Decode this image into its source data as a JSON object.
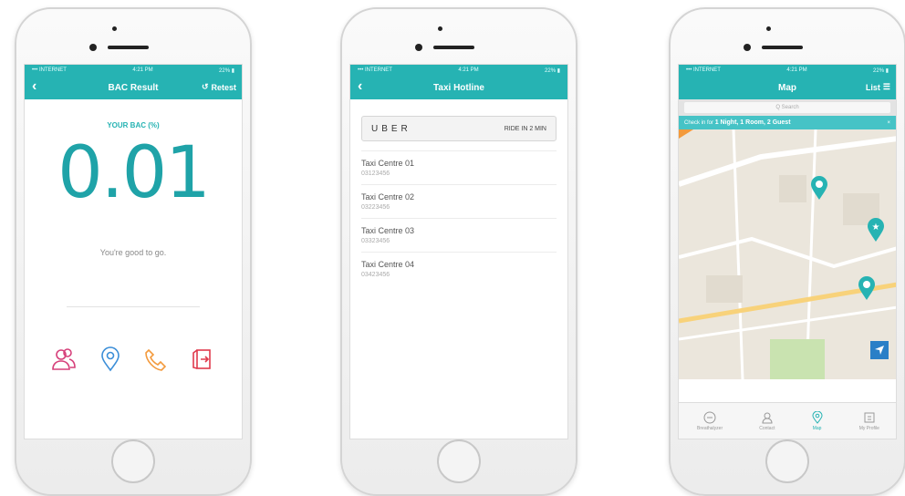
{
  "status": {
    "carrier": "••• INTERNET",
    "time": "4:21 PM",
    "battery": "22% ▮"
  },
  "bac_screen": {
    "title": "BAC Result",
    "retest_label": "Retest",
    "bac_label": "YOUR BAC (%)",
    "bac_value": "0.01",
    "message": "You're good to go."
  },
  "taxi_screen": {
    "title": "Taxi Hotline",
    "uber_logo": "UBER",
    "uber_eta": "RIDE IN 2 MIN",
    "taxis": [
      {
        "name": "Taxi Centre 01",
        "phone": "03123456"
      },
      {
        "name": "Taxi Centre 02",
        "phone": "03223456"
      },
      {
        "name": "Taxi Centre 03",
        "phone": "03323456"
      },
      {
        "name": "Taxi Centre 04",
        "phone": "03423456"
      }
    ]
  },
  "map_screen": {
    "title": "Map",
    "list_label": "List",
    "search_placeholder": "Q Search",
    "promo_prefix": "Check in for",
    "promo_bold": "1 Night, 1 Room, 2 Guest",
    "tabs": [
      "Breathalyzer",
      "Contact",
      "Map",
      "My Profile"
    ]
  },
  "colors": {
    "accent": "#26b3b3",
    "pink": "#d6407a",
    "blue": "#3b8ed8",
    "orange": "#f39a3c",
    "red": "#e03a4c"
  }
}
